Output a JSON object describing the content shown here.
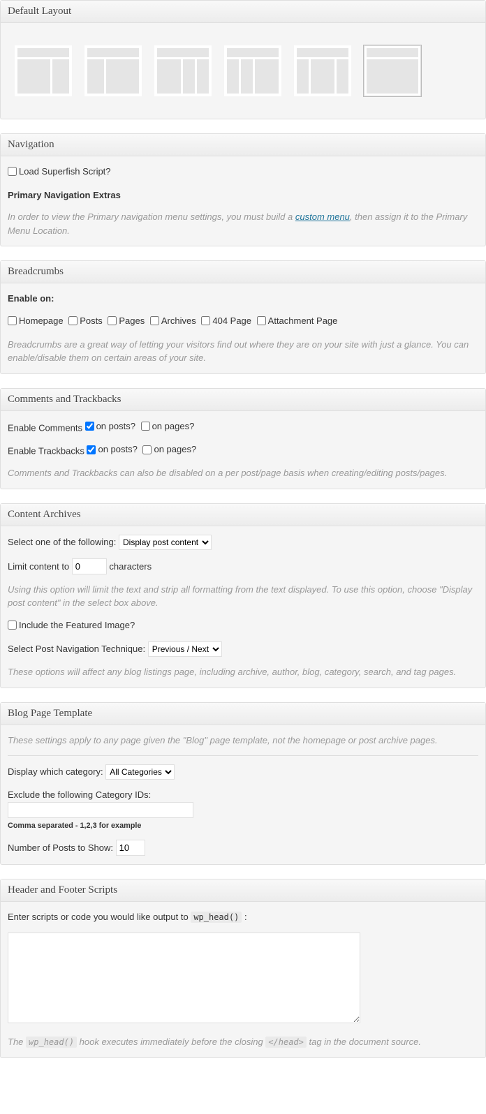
{
  "defaultLayout": {
    "title": "Default Layout"
  },
  "navigation": {
    "title": "Navigation",
    "superfish_label": "Load Superfish Script?",
    "extras_heading": "Primary Navigation Extras",
    "desc_before": "In order to view the Primary navigation menu settings, you must build a ",
    "desc_link": "custom menu",
    "desc_after": ", then assign it to the Primary Menu Location."
  },
  "breadcrumbs": {
    "title": "Breadcrumbs",
    "enable_on": "Enable on:",
    "homepage": "Homepage",
    "posts": "Posts",
    "pages": "Pages",
    "archives": "Archives",
    "page404": "404 Page",
    "attachment": "Attachment Page",
    "desc": "Breadcrumbs are a great way of letting your visitors find out where they are on your site with just a glance. You can enable/disable them on certain areas of your site."
  },
  "comments": {
    "title": "Comments and Trackbacks",
    "enable_comments": "Enable Comments",
    "enable_trackbacks": "Enable Trackbacks",
    "on_posts": "on posts?",
    "on_pages": "on pages?",
    "desc": "Comments and Trackbacks can also be disabled on a per post/page basis when creating/editing posts/pages."
  },
  "archives": {
    "title": "Content Archives",
    "select_one": "Select one of the following:",
    "select_value": "Display post content",
    "limit_before": "Limit content to",
    "limit_value": "0",
    "limit_after": "characters",
    "limit_desc": "Using this option will limit the text and strip all formatting from the text displayed. To use this option, choose \"Display post content\" in the select box above.",
    "featured_label": "Include the Featured Image?",
    "nav_label": "Select Post Navigation Technique:",
    "nav_value": "Previous / Next",
    "footer_desc": "These options will affect any blog listings page, including archive, author, blog, category, search, and tag pages."
  },
  "blog": {
    "title": "Blog Page Template",
    "desc": "These settings apply to any page given the \"Blog\" page template, not the homepage or post archive pages.",
    "display_cat": "Display which category:",
    "cat_value": "All Categories",
    "exclude_label": "Exclude the following Category IDs:",
    "exclude_hint": "Comma separated - 1,2,3 for example",
    "num_posts_label": "Number of Posts to Show:",
    "num_posts_value": "10"
  },
  "scripts": {
    "title": "Header and Footer Scripts",
    "enter_label_before": "Enter scripts or code you would like output to ",
    "wp_head": "wp_head()",
    "enter_label_after": " :",
    "desc_before": "The ",
    "desc_mid": " hook executes immediately before the closing ",
    "head_tag": "</head>",
    "desc_after": " tag in the document source."
  }
}
